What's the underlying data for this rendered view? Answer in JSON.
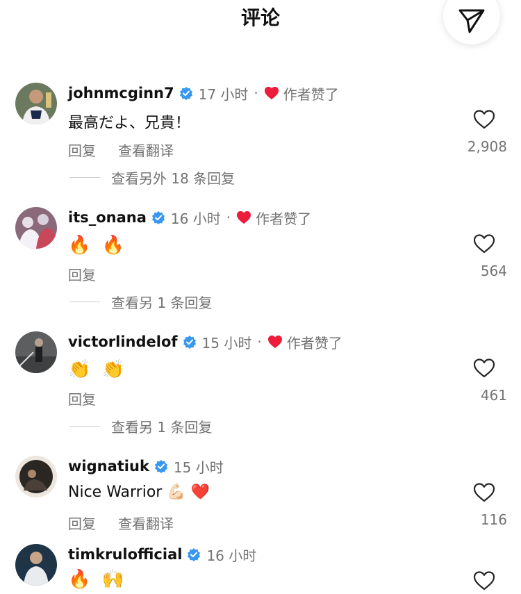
{
  "header": {
    "title": "评论",
    "send_icon": "send-arrow-icon"
  },
  "verified_color": "#3897f0",
  "heart_color": "#ed1c3a",
  "comments": [
    {
      "username": "johnmcginn7",
      "time": "17 小时",
      "dot": "·",
      "liked_by_author": "作者赞了",
      "text": "最高だよ、兄貴！",
      "reply": "回复",
      "translate": "查看翻译",
      "likes": "2,908",
      "view_replies": "查看另外 18 条回复"
    },
    {
      "username": "its_onana",
      "time": "16 小时",
      "dot": "·",
      "liked_by_author": "作者赞了",
      "text": "🔥 🔥",
      "reply": "回复",
      "likes": "564",
      "view_replies": "查看另 1 条回复"
    },
    {
      "username": "victorlindelof",
      "time": "15 小时",
      "dot": "·",
      "liked_by_author": "作者赞了",
      "text": "👏 👏",
      "reply": "回复",
      "likes": "461",
      "view_replies": "查看另 1 条回复"
    },
    {
      "username": "wignatiuk",
      "time": "15 小时",
      "text": "Nice Warrior 💪🏻 ❤️",
      "reply": "回复",
      "translate": "查看翻译",
      "likes": "116"
    },
    {
      "username": "timkrulofficial",
      "time": "16 小时",
      "text": "🔥 🙌"
    }
  ]
}
